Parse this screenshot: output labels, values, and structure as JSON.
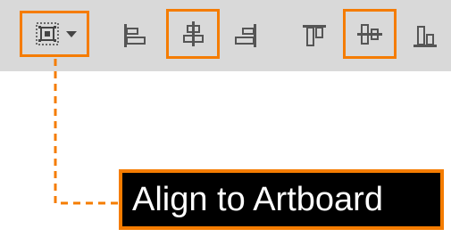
{
  "toolbar": {
    "tools": [
      {
        "id": "align-to-dropdown",
        "icon": "align-to-selection-icon",
        "highlighted": true
      },
      {
        "id": "horizontal-align-left",
        "icon": "horizontal-align-left-icon",
        "highlighted": false
      },
      {
        "id": "horizontal-align-center",
        "icon": "horizontal-align-center-icon",
        "highlighted": true
      },
      {
        "id": "horizontal-align-right",
        "icon": "horizontal-align-right-icon",
        "highlighted": false
      },
      {
        "id": "vertical-align-top",
        "icon": "vertical-align-top-icon",
        "highlighted": false
      },
      {
        "id": "vertical-align-center",
        "icon": "vertical-align-center-icon",
        "highlighted": true
      },
      {
        "id": "vertical-align-bottom",
        "icon": "vertical-align-bottom-icon",
        "highlighted": false
      }
    ]
  },
  "callout": {
    "label": "Align to Artboard"
  },
  "colors": {
    "highlight": "#f57c00",
    "toolbar_bg": "#d9d9d9",
    "label_bg": "#000000",
    "label_text": "#ffffff"
  }
}
